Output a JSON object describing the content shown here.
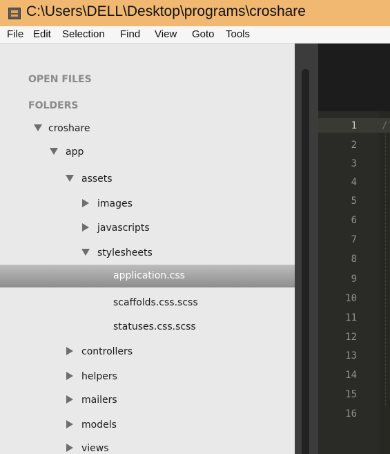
{
  "window": {
    "title": "C:\\Users\\DELL\\Desktop\\programs\\croshare",
    "brand_color": "#f0b870"
  },
  "menu": [
    "File",
    "Edit",
    "Selection",
    "Find",
    "View",
    "Goto",
    "Tools"
  ],
  "sidebar": {
    "open_files_label": "OPEN FILES",
    "folders_label": "FOLDERS",
    "tree": [
      {
        "label": "croshare",
        "expanded": true
      },
      {
        "label": "app",
        "expanded": true
      },
      {
        "label": "assets",
        "expanded": true
      },
      {
        "label": "images",
        "expanded": false
      },
      {
        "label": "javascripts",
        "expanded": false
      },
      {
        "label": "stylesheets",
        "expanded": true
      },
      {
        "label": "application.css",
        "selected": true
      },
      {
        "label": "scaffolds.css.scss"
      },
      {
        "label": "statuses.css.scss"
      },
      {
        "label": "controllers",
        "expanded": false
      },
      {
        "label": "helpers",
        "expanded": false
      },
      {
        "label": "mailers",
        "expanded": false
      },
      {
        "label": "models",
        "expanded": false
      },
      {
        "label": "views",
        "expanded": false
      }
    ]
  },
  "editor": {
    "line_numbers": [
      "1",
      "2",
      "3",
      "4",
      "5",
      "6",
      "7",
      "8",
      "9",
      "10",
      "11",
      "12",
      "13",
      "14",
      "15",
      "16"
    ],
    "current_line": "1",
    "first_line_text": "/"
  }
}
